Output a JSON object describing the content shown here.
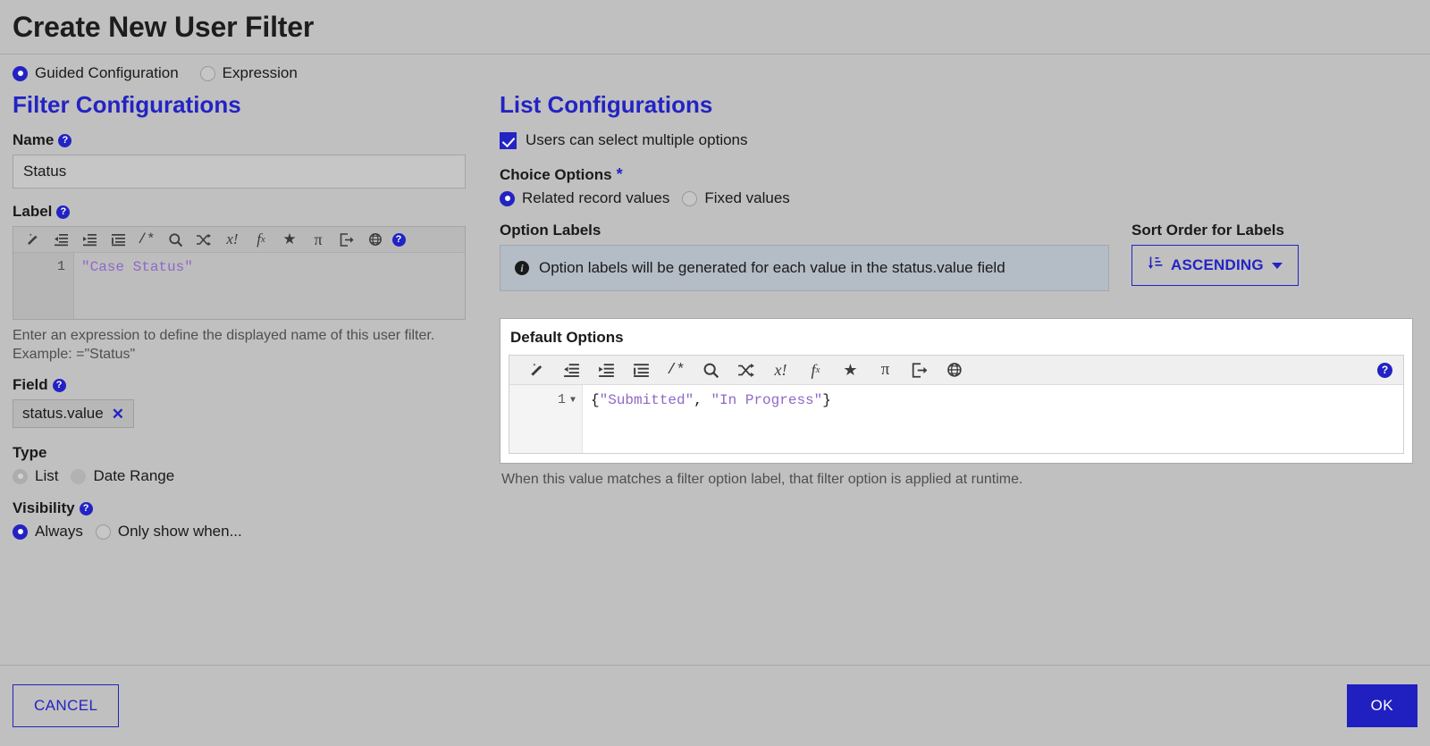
{
  "dialog": {
    "title": "Create New User Filter"
  },
  "mode": {
    "options": [
      {
        "label": "Guided Configuration",
        "selected": true
      },
      {
        "label": "Expression",
        "selected": false
      }
    ]
  },
  "filter_configurations": {
    "heading": "Filter Configurations",
    "name": {
      "label": "Name",
      "help": "?",
      "value": "Status"
    },
    "label_field": {
      "label": "Label",
      "help": "?",
      "line_number": "1",
      "expression": "\"Case Status\"",
      "hint": "Enter an expression to define the displayed name of this user filter. Example: =\"Status\"",
      "toolbar_icons": [
        "magic-wand-icon",
        "outdent-icon",
        "indent-icon",
        "list-icon",
        "comment-icon",
        "search-icon",
        "shuffle-icon",
        "clear-variable-icon",
        "function-icon",
        "star-icon",
        "pi-icon",
        "export-icon",
        "globe-icon",
        "help-icon"
      ]
    },
    "field": {
      "label": "Field",
      "help": "?",
      "chip_value": "status.value",
      "remove_label": "✕"
    },
    "type": {
      "label": "Type",
      "options": [
        {
          "label": "List",
          "selected": true,
          "disabled": true
        },
        {
          "label": "Date Range",
          "selected": false,
          "disabled": true
        }
      ]
    },
    "visibility": {
      "label": "Visibility",
      "help": "?",
      "options": [
        {
          "label": "Always",
          "selected": true
        },
        {
          "label": "Only show when...",
          "selected": false
        }
      ]
    }
  },
  "list_configurations": {
    "heading": "List Configurations",
    "multiselect": {
      "label": "Users can select multiple options",
      "checked": true
    },
    "choice_options": {
      "label": "Choice Options",
      "required_marker": "*",
      "options": [
        {
          "label": "Related record values",
          "selected": true
        },
        {
          "label": "Fixed values",
          "selected": false
        }
      ]
    },
    "option_labels": {
      "label": "Option Labels",
      "info_text": "Option labels will be generated for each value in the status.value field"
    },
    "sort_order": {
      "label": "Sort Order for Labels",
      "button_text": "ASCENDING"
    },
    "default_options": {
      "title": "Default Options",
      "line_number": "1",
      "expression": "{\"Submitted\", \"In Progress\"}",
      "expr_open_brace": "{",
      "expr_value_1": "\"Submitted\"",
      "expr_comma": ", ",
      "expr_value_2": "\"In Progress\"",
      "expr_close_brace": "}",
      "hint": "When this value matches a filter option label, that filter option is applied at runtime.",
      "toolbar_icons": [
        "magic-wand-icon",
        "outdent-icon",
        "indent-icon",
        "list-icon",
        "comment-icon",
        "search-icon",
        "shuffle-icon",
        "clear-variable-icon",
        "function-icon",
        "star-icon",
        "pi-icon",
        "export-icon",
        "globe-icon"
      ],
      "help": "?"
    }
  },
  "footer": {
    "cancel_label": "CANCEL",
    "ok_label": "OK"
  },
  "colors": {
    "accent": "#2323c4",
    "ok_button": "#2020c0",
    "background": "#c0c0c0",
    "code_string": "#8f67c9",
    "info_box": "#b4bcc6"
  }
}
